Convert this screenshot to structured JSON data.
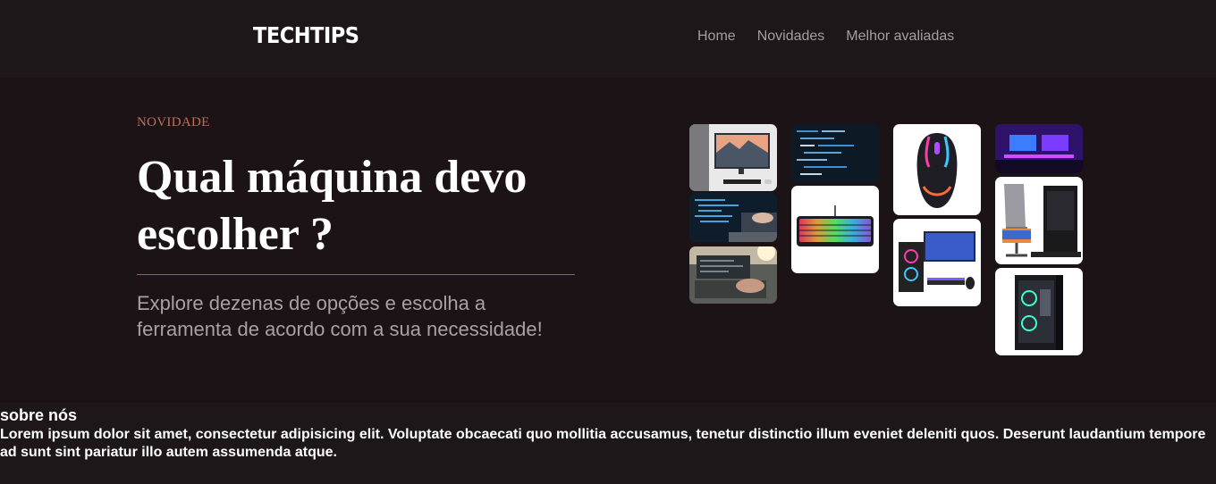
{
  "header": {
    "logo": "TECHTIPS",
    "nav": [
      "Home",
      "Novidades",
      "Melhor avaliadas"
    ]
  },
  "hero": {
    "kicker": "NOVIDADE",
    "title": "Qual máquina devo escolher ?",
    "subtitle": "Explore dezenas de opções e escolha a ferramenta de acordo com a sua necessidade!"
  },
  "gallery": {
    "images": [
      "desktop-monitor-photo",
      "code-laptop-photo",
      "laptop-typing-photo",
      "code-screen-photo",
      "rgb-keyboard-photo",
      "gaming-mouse-photo",
      "gaming-pc-setup-photo",
      "gaming-room-photo",
      "gaming-chair-desk-photo",
      "pc-tower-photo"
    ]
  },
  "about": {
    "heading": "sobre nós",
    "text": "Lorem ipsum dolor sit amet, consectetur adipisicing elit. Voluptate obcaecati quo mollitia accusamus, tenetur distinctio illum eveniet deleniti quos. Deserunt laudantium tempore ad sunt sint pariatur illo autem assumenda atque."
  },
  "colors": {
    "background": "#1b1316",
    "header": "#1e1719",
    "accent": "#c0705a",
    "nav_text": "#a39e9f"
  }
}
